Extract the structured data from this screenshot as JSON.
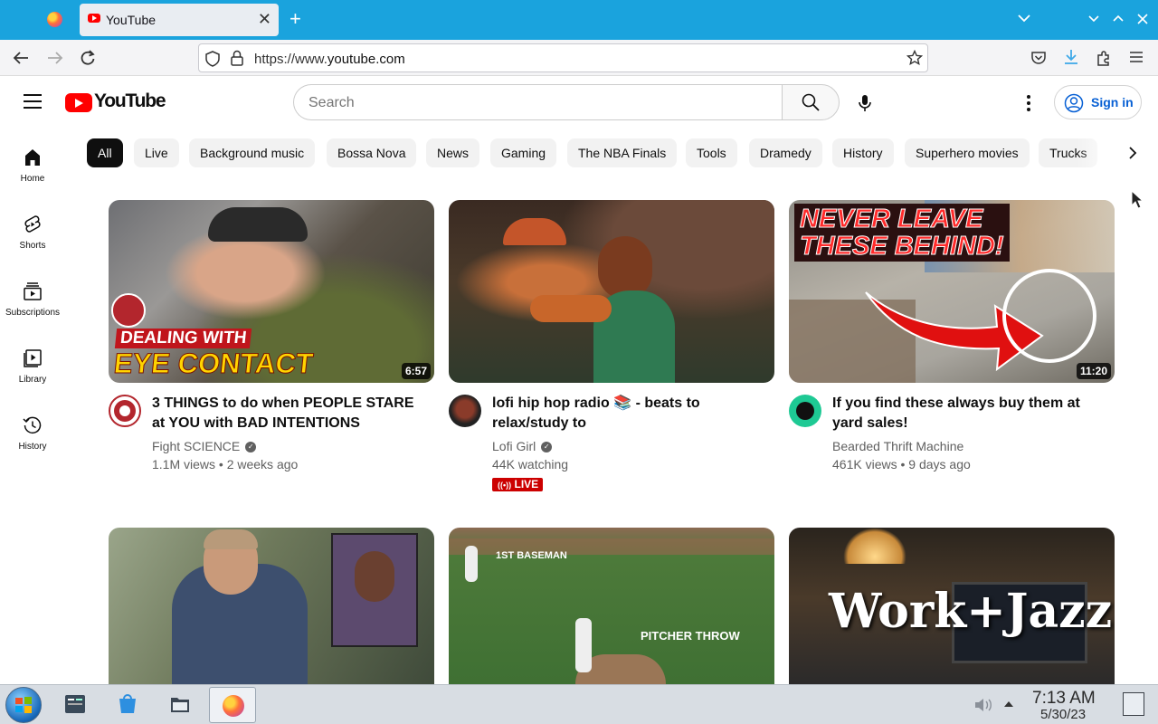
{
  "browser": {
    "tab_title": "YouTube",
    "tab_close": "✕",
    "new_tab": "+",
    "url_scheme": "https://www.",
    "url_domain": "youtube.com"
  },
  "youtube": {
    "logo_text": "YouTube",
    "search_placeholder": "Search",
    "sign_in": "Sign in",
    "sidebar": [
      {
        "label": "Home",
        "icon": "home-icon"
      },
      {
        "label": "Shorts",
        "icon": "shorts-icon"
      },
      {
        "label": "Subscriptions",
        "icon": "subscriptions-icon"
      },
      {
        "label": "Library",
        "icon": "library-icon"
      },
      {
        "label": "History",
        "icon": "history-icon"
      }
    ],
    "chips": [
      "All",
      "Live",
      "Background music",
      "Bossa Nova",
      "News",
      "Gaming",
      "The NBA Finals",
      "Tools",
      "Dramedy",
      "History",
      "Superhero movies",
      "Trucks"
    ],
    "videos": [
      {
        "title": "3 THINGS to do when PEOPLE STARE at YOU with BAD INTENTIONS",
        "channel": "Fight SCIENCE",
        "verified": true,
        "meta": "1.1M views • 2 weeks ago",
        "duration": "6:57",
        "thumb_text": [
          "DEALING WITH",
          "EYE CONTACT"
        ]
      },
      {
        "title": "lofi hip hop radio 📚 - beats to relax/study to",
        "channel": "Lofi Girl",
        "verified": true,
        "meta": "44K watching",
        "live": "LIVE"
      },
      {
        "title": "If you find these always buy them at yard sales!",
        "channel": "Bearded Thrift Machine",
        "verified": false,
        "meta": "461K views • 9 days ago",
        "duration": "11:20",
        "thumb_text": [
          "NEVER LEAVE",
          "THESE BEHIND!"
        ]
      },
      {
        "thumb_text": []
      },
      {
        "thumb_text": [
          "1ST BASEMAN",
          "PITCHER THROW"
        ]
      },
      {
        "thumb_text": [
          "Work+Jazz"
        ]
      }
    ]
  },
  "taskbar": {
    "time": "7:13 AM",
    "date": "5/30/23"
  }
}
